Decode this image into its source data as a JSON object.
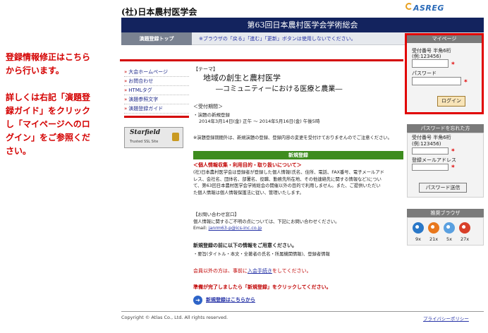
{
  "annotation": {
    "lines": [
      "登録情報修正はこちら",
      "から行います。",
      "",
      "詳しくは右記「演題登",
      "録ガイド」をクリック",
      "し「マイページへのロ",
      "グイン」をご参照くだ",
      "さい。"
    ]
  },
  "header": {
    "org_title": "(社)日本農村医学会",
    "logo": "ASREG",
    "banner": "第63回日本農村医学会学術総会",
    "nav_tab": "演題登録トップ",
    "nav_note": "※ブラウザの「戻る」「進む」「更新」ボタンは使用しないでください。"
  },
  "menu": {
    "items": [
      "大会ホームページ",
      "お問合わせ",
      "HTMLタグ",
      "演題参照文字",
      "演題登録ガイド"
    ],
    "bullet": "»"
  },
  "ssl": {
    "brand": "Starfield",
    "sub": "Trusted SSL Site"
  },
  "theme": {
    "label": "【テーマ】",
    "main": "地域の創生と農村医学",
    "sub": "―コミュニティーにおける医療と農業―"
  },
  "period": {
    "label": "＜受付期間＞",
    "line1": "・演題の新規登録",
    "line2": "2014年3月14日(金) 正午 ～ 2014年5月16日(金) 午後5時"
  },
  "notice": "※演題登録期間外は、新規演題の登録、登録内容の変更を受付けておりませんのでご注意ください。",
  "new_reg_bar": "新規登録",
  "privacy": {
    "title": "＜個人情報収集・利用目的・取り扱いについて＞",
    "lines": [
      "(社)日本農村医学会は登録者が登録した個人情報(氏名、住所、電話、FAX番号、電子メールアド",
      "レス、会社名、団体名、部署名、役職、勤務先所在地、その他連絡先に関する情報など)につい",
      "て、第63回日本農村医学会学術総会の開催以外の目的で利用しません。また、ご提供いただい",
      "た個人情報は個人情報保護法に従い、管理いたします。"
    ]
  },
  "inquiry": {
    "title": "【お問い合わせ窓口】",
    "body": "個人情報に関するご不明の点については、下記にお問い合わせください。",
    "email_label": "Email: ",
    "email": "janrm63-p@ics-inc.co.jp"
  },
  "prep": {
    "title": "新規登録の前に以下の情報をご用意ください。",
    "body": "・要旨(タイトル・本文・全著者の氏名・所属機関情報)、登録者情報"
  },
  "nonmember": {
    "pre": "会員以外の方は、事前に",
    "link": "入会手続き",
    "post": "をしてください。"
  },
  "ready": "準備が完了しましたら「新規登録」をクリックしてください。",
  "reg_link": "新規登録はこちらから",
  "mypage": {
    "title": "マイページ",
    "id_label1": "受付番号 半角6桁",
    "id_label2": "(例:123456)",
    "id_value": "",
    "pw_label": "パスワード",
    "pw_value": "",
    "required": "*",
    "login": "ログイン"
  },
  "forgot": {
    "title": "パスワードを忘れた方",
    "id_label1": "受付番号 半角6桁",
    "id_label2": "(例:123456)",
    "id_value": "",
    "email_label": "登録メールアドレス",
    "email_value": "",
    "required": "*",
    "button": "パスワード送信"
  },
  "browsers": {
    "title": "推奨ブラウザ",
    "items": [
      {
        "label": "9x",
        "icon": "ie-icon",
        "color": "#2a78c8"
      },
      {
        "label": "21x",
        "icon": "firefox-icon",
        "color": "#e8781e"
      },
      {
        "label": "5x",
        "icon": "safari-icon",
        "color": "#5aa0e0"
      },
      {
        "label": "27x",
        "icon": "chrome-icon",
        "color": "#d8402a"
      }
    ]
  },
  "footer": {
    "copyright": "Copyright © Atlas Co., Ltd. All rights reserved.",
    "privacy": "プライバシーポリシー"
  }
}
